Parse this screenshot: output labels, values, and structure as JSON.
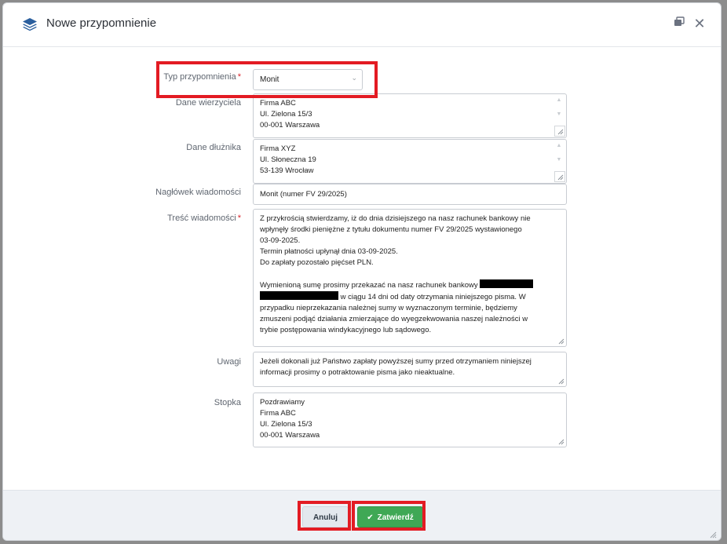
{
  "dialog": {
    "title": "Nowe przypomnienie",
    "icons": {
      "app": "layers-icon",
      "restore": "restore-window-icon",
      "close": "close-icon"
    }
  },
  "form": {
    "type": {
      "label": "Typ przypomnienia",
      "required": "*",
      "value": "Monit"
    },
    "creditor": {
      "label": "Dane wierzyciela",
      "lines": [
        "Firma ABC",
        "Ul. Zielona 15/3",
        "00-001 Warszawa"
      ]
    },
    "debtor": {
      "label": "Dane dłużnika",
      "lines": [
        "Firma XYZ",
        "Ul. Słoneczna 19",
        "53-139 Wrocław"
      ]
    },
    "header": {
      "label": "Nagłówek wiadomości",
      "value": "Monit (numer FV 29/2025)"
    },
    "content": {
      "label": "Treść wiadomości",
      "required": "*",
      "lines": [
        "Z przykrością stwierdzamy, iż do dnia dzisiejszego na nasz rachunek bankowy nie",
        "wpłynęły środki pieniężne z tytułu dokumentu numer FV 29/2025 wystawionego",
        "03-09-2025.",
        "Termin płatności upłynął dnia 03-09-2025.",
        "Do zapłaty pozostało pięćset PLN.",
        "",
        "Wymienioną sumę prosimy przekazać na nasz rachunek bankowy",
        " w ciągu 14 dni od daty otrzymania niniejszego pisma. W",
        "przypadku nieprzekazania należnej sumy w wyznaczonym terminie, będziemy",
        "zmuszeni podjąć działania zmierzające do wyegzekwowania naszej należności w",
        "trybie postępowania windykacyjnego lub sądowego."
      ]
    },
    "notes": {
      "label": "Uwagi",
      "lines": [
        "Jeżeli dokonali już Państwo zapłaty powyższej sumy przed otrzymaniem niniejszej",
        "informacji prosimy o potraktowanie pisma jako nieaktualne."
      ]
    },
    "footer": {
      "label": "Stopka",
      "lines": [
        "Pozdrawiamy",
        "Firma ABC",
        "Ul. Zielona 15/3",
        "00-001 Warszawa"
      ]
    }
  },
  "buttons": {
    "cancel": "Anuluj",
    "confirm": "Zatwierdź"
  },
  "colors": {
    "highlight": "#e31b23",
    "confirm": "#3fa855",
    "required": "#d9252d",
    "app_icon": "#2b5f9e"
  }
}
